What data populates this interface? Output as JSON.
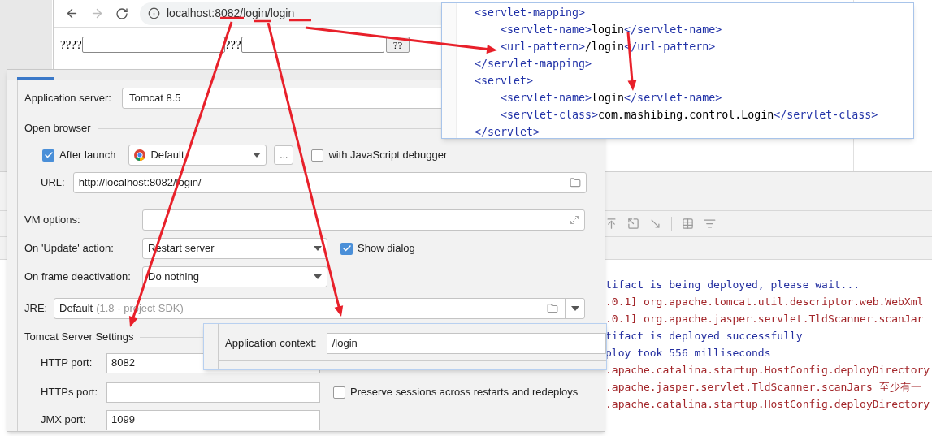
{
  "browser": {
    "address": "localhost:8082/login/login",
    "form": {
      "label_1": "????",
      "label_2": "???",
      "button": "??"
    }
  },
  "run_dialog": {
    "tab_selected": true,
    "application_server": {
      "label": "Application server:",
      "value": "Tomcat 8.5"
    },
    "open_browser": {
      "title": "Open browser",
      "after_launch": {
        "label": "After launch",
        "checked": true
      },
      "browser": "Default",
      "more_button": "...",
      "js_debugger": {
        "label": "with JavaScript debugger",
        "checked": false
      },
      "url": {
        "label": "URL:",
        "value": "http://localhost:8082/login/"
      }
    },
    "vm_options": {
      "label": "VM options:"
    },
    "update_action": {
      "label": "On 'Update' action:",
      "value": "Restart server"
    },
    "show_dialog": {
      "label": "Show dialog",
      "checked": true
    },
    "frame_deactivation": {
      "label": "On frame deactivation:",
      "value": "Do nothing"
    },
    "jre": {
      "label": "JRE:",
      "value": "Default",
      "hint": "(1.8 - project SDK)"
    },
    "tomcat_settings": {
      "title": "Tomcat Server Settings",
      "http_port": {
        "label": "HTTP port:",
        "value": "8082"
      },
      "https_port": {
        "label": "HTTPs port:"
      },
      "preserve_sessions": {
        "label": "Preserve sessions across restarts and redeploys",
        "checked": false
      },
      "jmx_port": {
        "label": "JMX port:",
        "value": "1099"
      }
    }
  },
  "web_xml": {
    "lines": [
      {
        "indent": false,
        "tag": "<servlet-mapping>"
      },
      {
        "indent": true,
        "tag": "<servlet-name>",
        "text": "login",
        "close": "</servlet-name>"
      },
      {
        "indent": true,
        "tag": "<url-pattern>",
        "text": "/login",
        "close": "</url-pattern>"
      },
      {
        "indent": false,
        "tag": "</servlet-mapping>"
      },
      {
        "indent": false,
        "tag": "<servlet>"
      },
      {
        "indent": true,
        "tag": "<servlet-name>",
        "text": "login",
        "close": "</servlet-name>"
      },
      {
        "indent": true,
        "tag": "<servlet-class>",
        "text": "com.mashibing.control.Login",
        "close": "</servlet-class>"
      },
      {
        "indent": false,
        "tag": "</servlet>"
      }
    ]
  },
  "deployment": {
    "application_context": {
      "label": "Application context:",
      "value": "/login"
    }
  },
  "console": {
    "lines": [
      {
        "kind": "info",
        "text": "tifact is being deployed, please wait..."
      },
      {
        "kind": "log",
        "text": ".0.1] org.apache.tomcat.util.descriptor.web.WebXml"
      },
      {
        "kind": "log",
        "text": ".0.1] org.apache.jasper.servlet.TldScanner.scanJar"
      },
      {
        "kind": "info",
        "text": "tifact is deployed successfully"
      },
      {
        "kind": "info",
        "text": "ploy took 556 milliseconds"
      },
      {
        "kind": "log",
        "text": ".apache.catalina.startup.HostConfig.deployDirectory"
      },
      {
        "kind": "log",
        "text": ".apache.jasper.servlet.TldScanner.scanJars 至少有一"
      },
      {
        "kind": "log",
        "text": ".apache.catalina.startup.HostConfig.deployDirectory"
      }
    ]
  }
}
